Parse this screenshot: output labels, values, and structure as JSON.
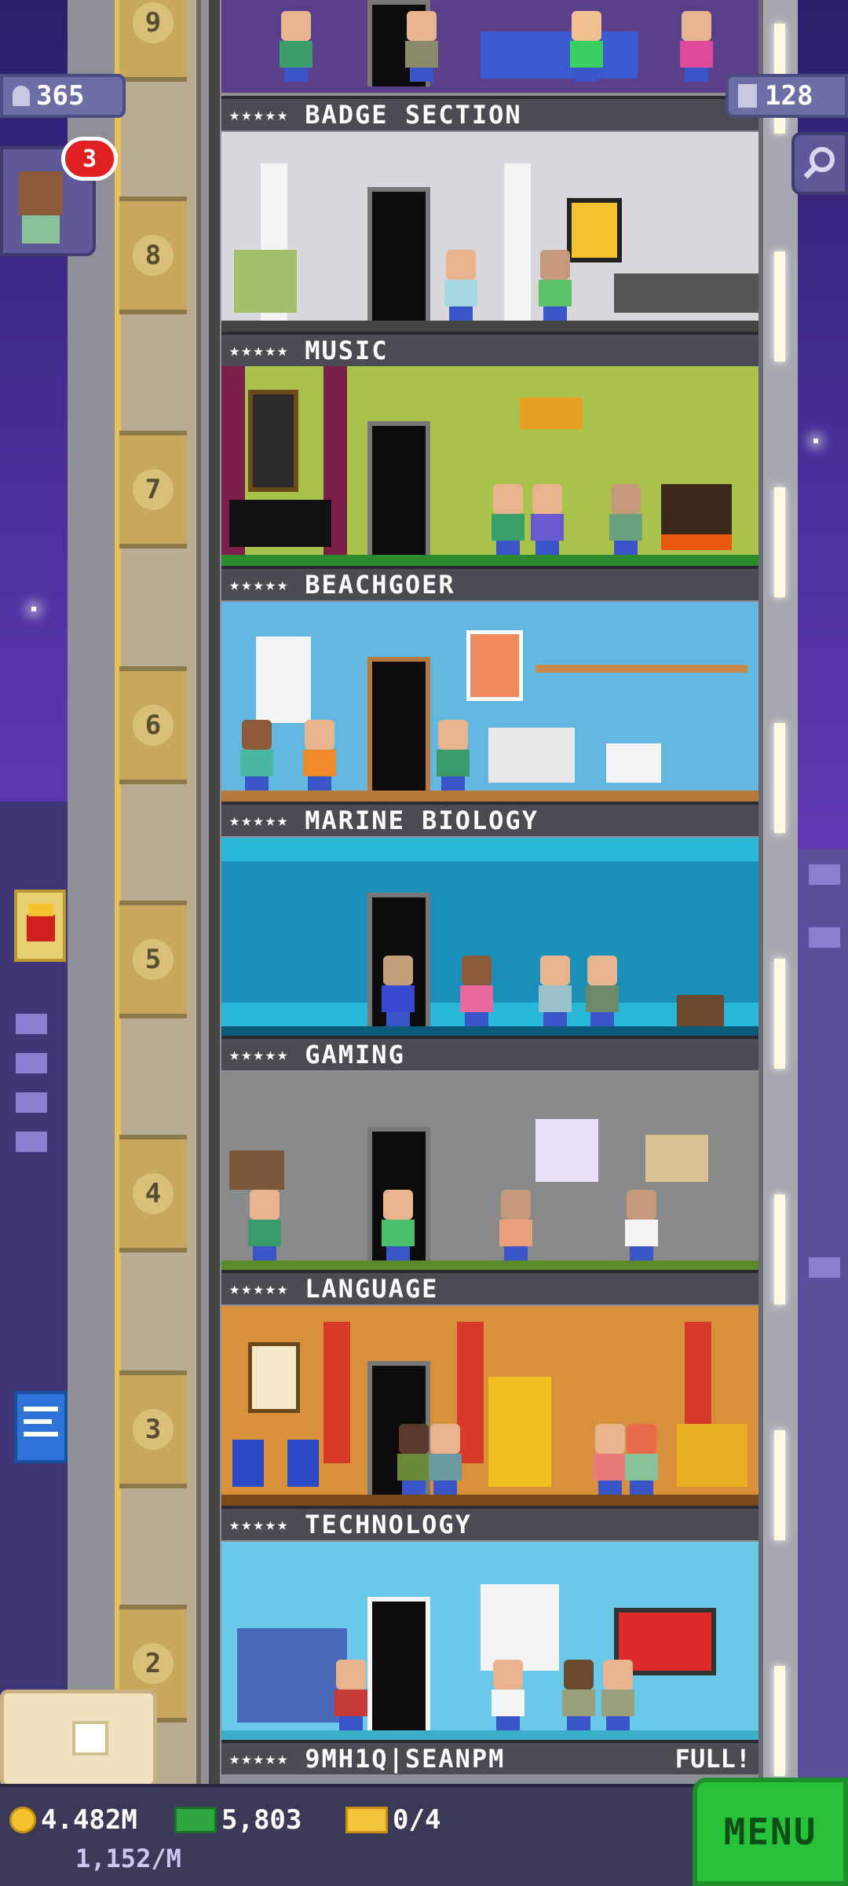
{
  "hud": {
    "population": "365",
    "floors_count": "128",
    "notification_count": "3"
  },
  "floors": [
    {
      "number": "9",
      "name": "BADGE SECTION",
      "stars": "★★★★★"
    },
    {
      "number": "8",
      "name": "MUSIC",
      "stars": "★★★★★"
    },
    {
      "number": "7",
      "name": "BEACHGOER",
      "stars": "★★★★★"
    },
    {
      "number": "6",
      "name": "MARINE BIOLOGY",
      "stars": "★★★★★"
    },
    {
      "number": "5",
      "name": "GAMING",
      "stars": "★★★★★"
    },
    {
      "number": "4",
      "name": "LANGUAGE",
      "stars": "★★★★★"
    },
    {
      "number": "3",
      "name": "TECHNOLOGY",
      "stars": "★★★★★"
    },
    {
      "number": "2",
      "name": "9MH1Q|SEANPM",
      "stars": "★★★★★",
      "status": "FULL!"
    }
  ],
  "bottom_bar": {
    "coins": "4.482M",
    "coins_rate": "1,152/M",
    "bux": "5,803",
    "tickets": "0/4",
    "menu_label": "MENU"
  },
  "colors": {
    "accent_green": "#27c23a",
    "notification_red": "#e02020",
    "sky_purple": "#6a3fbf"
  }
}
